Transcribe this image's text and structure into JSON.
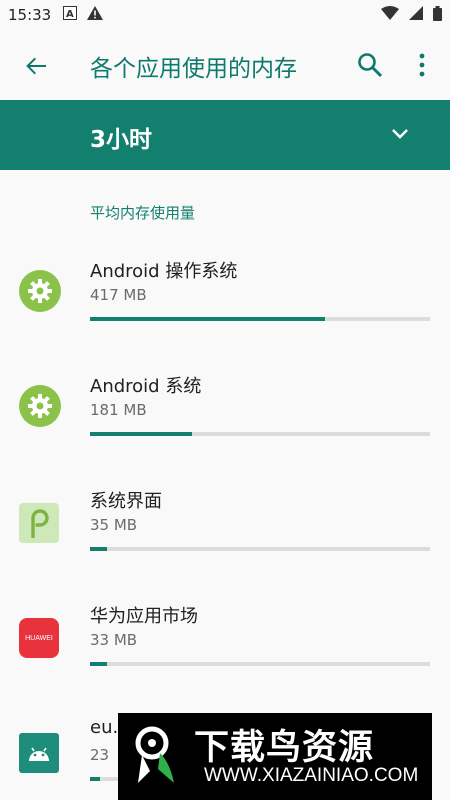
{
  "status_bar": {
    "time": "15:33",
    "icons": [
      "text-a-icon",
      "warning-icon",
      "wifi-icon",
      "signal-icon",
      "battery-icon"
    ]
  },
  "app_bar": {
    "title": "各个应用使用的内存",
    "icons": [
      "back-arrow-icon",
      "search-icon",
      "more-vert-icon"
    ]
  },
  "filter": {
    "value": "3小时"
  },
  "section": {
    "header": "平均内存使用量"
  },
  "apps": [
    {
      "name": "Android 操作系统",
      "size": "417 MB",
      "usage_fraction": 0.69,
      "icon": "gear-icon"
    },
    {
      "name": "Android 系统",
      "size": "181 MB",
      "usage_fraction": 0.3,
      "icon": "gear-icon"
    },
    {
      "name": "系统界面",
      "size": "35 MB",
      "usage_fraction": 0.05,
      "icon": "android-p-icon"
    },
    {
      "name": "华为应用市场",
      "size": "33 MB",
      "usage_fraction": 0.05,
      "icon": "huawei-icon"
    },
    {
      "name": "eu.",
      "size": "23",
      "usage_fraction": 0.03,
      "icon": "android-robot-icon"
    }
  ],
  "huawei_icon_text": "HUAWEI",
  "watermark": {
    "title": "下载鸟资源",
    "url": "WWW.XIAZAINIAO.COM"
  },
  "colors": {
    "accent": "#137f6f",
    "title": "#0e7a6d",
    "track": "#dcdcdc",
    "gear_bg": "#8bc34a",
    "huawei": "#e8333c"
  }
}
